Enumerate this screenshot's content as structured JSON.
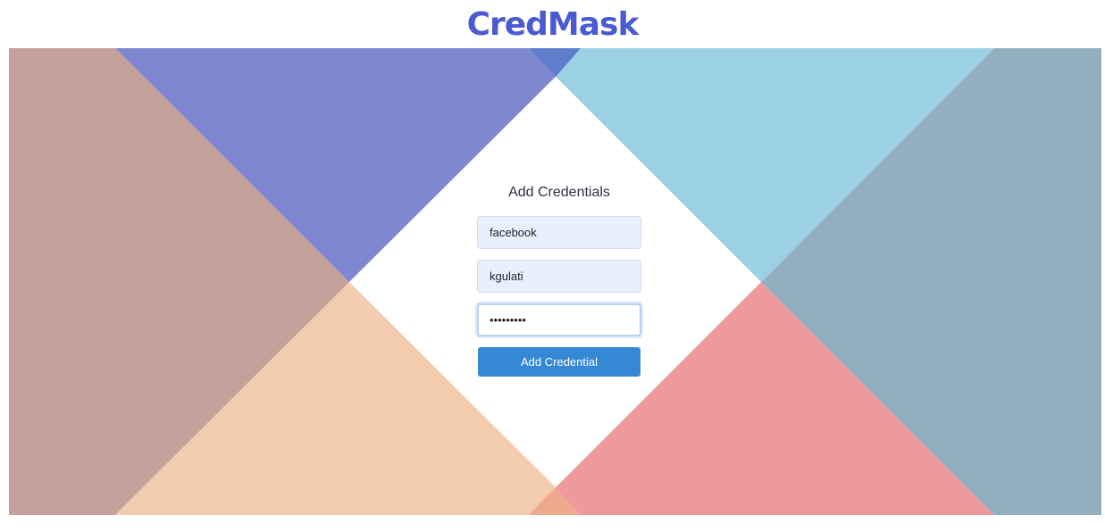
{
  "app": {
    "logo": "CredMask"
  },
  "form": {
    "title": "Add Credentials",
    "site_value": "facebook",
    "username_value": "kgulati",
    "password_value": "•••••••••",
    "submit_label": "Add Credential"
  },
  "colors": {
    "brand": "#4a5bd1",
    "button": "#3589d4",
    "panel_top_left": "#7f87d1",
    "panel_top_right": "#9bd1e3",
    "panel_left": "#c4a19b",
    "panel_right": "#92afc0",
    "panel_bottom_left": "#f3cbae",
    "panel_bottom_right": "#ec9a9b"
  }
}
